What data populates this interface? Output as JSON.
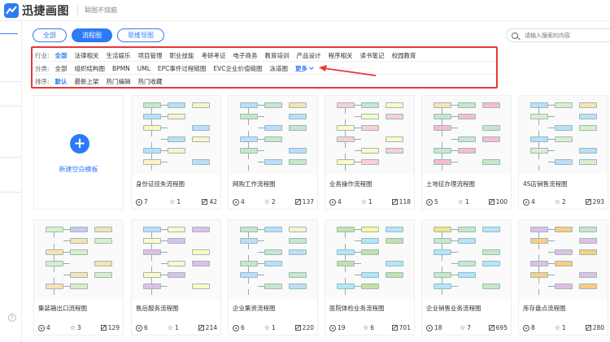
{
  "header": {
    "logo_text": "迅捷画图",
    "slogan": "聪图不烧脑"
  },
  "tabs": [
    {
      "label": "全部",
      "active": false
    },
    {
      "label": "流程图",
      "active": true
    },
    {
      "label": "思维导图",
      "active": false
    }
  ],
  "search": {
    "placeholder": "请输入搜索的内容"
  },
  "filters": {
    "industry": {
      "label": "行业:",
      "options": [
        "全部",
        "法律相关",
        "生活娱乐",
        "项目管理",
        "职业技能",
        "考研考证",
        "电子商务",
        "教育培训",
        "产品设计",
        "程序相关",
        "读书笔记",
        "校园教育"
      ],
      "selected": 0
    },
    "category": {
      "label": "分类:",
      "options": [
        "全部",
        "组织结构图",
        "BPMN",
        "UML",
        "EPC事件过程链图",
        "EVC企业价值链图",
        "泳道图"
      ],
      "selected": -1,
      "more": "更多"
    },
    "sort": {
      "label": "排序:",
      "options": [
        "默认",
        "最新上架",
        "热门编辑",
        "热门收藏"
      ],
      "selected": 0
    }
  },
  "new_template": {
    "label": "新建空白模板"
  },
  "cards": [
    {
      "title": "身份证挂失流程图",
      "views": "7",
      "stars": "1",
      "edits": "42"
    },
    {
      "title": "网购工作流程图",
      "views": "4",
      "stars": "2",
      "edits": "137"
    },
    {
      "title": "业务操作流程图",
      "views": "4",
      "stars": "1",
      "edits": "118"
    },
    {
      "title": "土地征办理流程图",
      "views": "5",
      "stars": "1",
      "edits": "100"
    },
    {
      "title": "4S店销售流程图",
      "views": "4",
      "stars": "2",
      "edits": "293"
    },
    {
      "title": "集装箱出口流程图",
      "views": "4",
      "stars": "3",
      "edits": "129"
    },
    {
      "title": "售后服务流程图",
      "views": "6",
      "stars": "1",
      "edits": "214"
    },
    {
      "title": "企业集资流程图",
      "views": "6",
      "stars": "1",
      "edits": "220"
    },
    {
      "title": "医院体检业务流程图",
      "views": "19",
      "stars": "6",
      "edits": "701"
    },
    {
      "title": "企业销售业务流程图",
      "views": "18",
      "stars": "7",
      "edits": "695"
    },
    {
      "title": "库存盘点流程图",
      "views": "8",
      "stars": "1",
      "edits": "280"
    }
  ],
  "colors": {
    "accent": "#2d7bf4",
    "annotation": "#e53935"
  }
}
